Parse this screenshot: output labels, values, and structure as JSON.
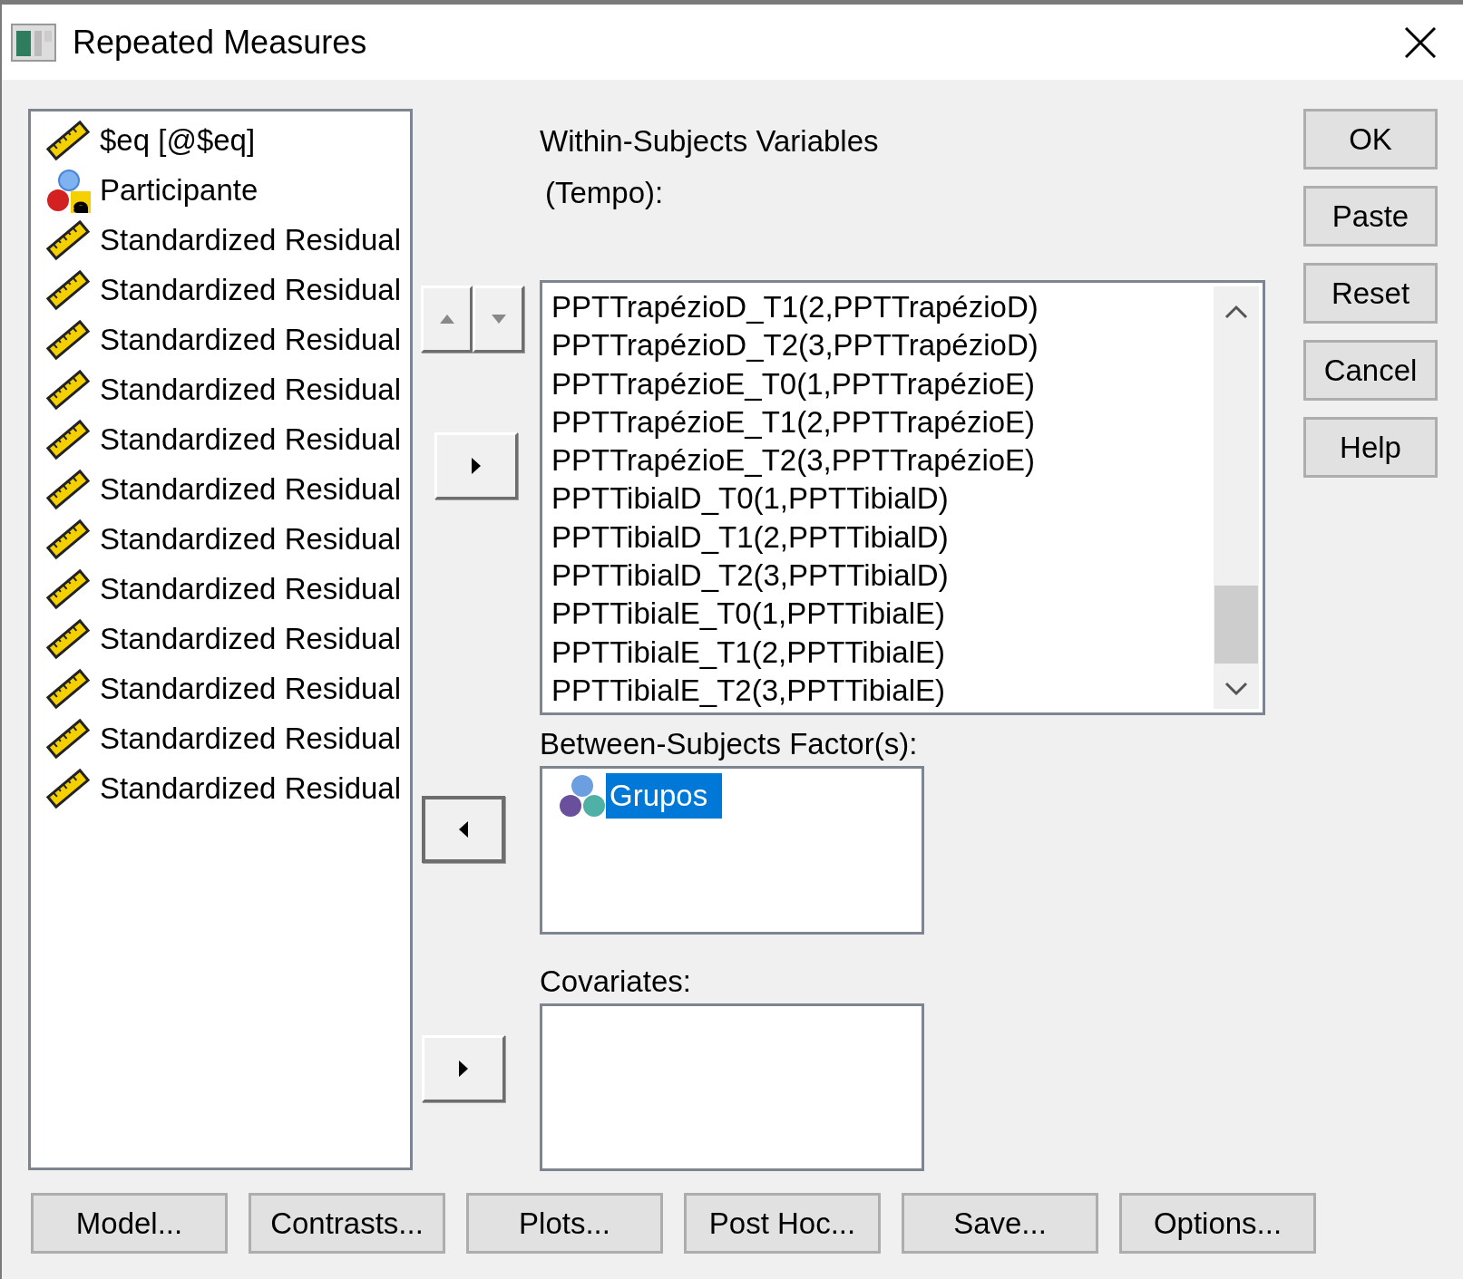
{
  "window": {
    "title": "Repeated Measures"
  },
  "variables": [
    {
      "label": "$eq [@$eq]",
      "kind": "scale"
    },
    {
      "label": "Participante",
      "kind": "nominal"
    },
    {
      "label": "Standardized Residual",
      "kind": "scale"
    },
    {
      "label": "Standardized Residual",
      "kind": "scale"
    },
    {
      "label": "Standardized Residual",
      "kind": "scale"
    },
    {
      "label": "Standardized Residual",
      "kind": "scale"
    },
    {
      "label": "Standardized Residual",
      "kind": "scale"
    },
    {
      "label": "Standardized Residual",
      "kind": "scale"
    },
    {
      "label": "Standardized Residual",
      "kind": "scale"
    },
    {
      "label": "Standardized Residual",
      "kind": "scale"
    },
    {
      "label": "Standardized Residual",
      "kind": "scale"
    },
    {
      "label": "Standardized Residual",
      "kind": "scale"
    },
    {
      "label": "Standardized Residual",
      "kind": "scale"
    },
    {
      "label": "Standardized Residual",
      "kind": "scale"
    }
  ],
  "within_subjects": {
    "label": "Within-Subjects Variables",
    "factor": "(Tempo):",
    "items": [
      "PPTTrapézioD_T1(2,PPTTrapézioD)",
      "PPTTrapézioD_T2(3,PPTTrapézioD)",
      "PPTTrapézioE_T0(1,PPTTrapézioE)",
      "PPTTrapézioE_T1(2,PPTTrapézioE)",
      "PPTTrapézioE_T2(3,PPTTrapézioE)",
      "PPTTibialD_T0(1,PPTTibialD)",
      "PPTTibialD_T1(2,PPTTibialD)",
      "PPTTibialD_T2(3,PPTTibialD)",
      "PPTTibialE_T0(1,PPTTibialE)",
      "PPTTibialE_T1(2,PPTTibialE)",
      "PPTTibialE_T2(3,PPTTibialE)"
    ]
  },
  "between_subjects": {
    "label": "Between-Subjects Factor(s):",
    "items": [
      {
        "label": "Grupos",
        "kind": "group",
        "selected": true
      }
    ]
  },
  "covariates": {
    "label": "Covariates:"
  },
  "side_buttons": [
    "OK",
    "Paste",
    "Reset",
    "Cancel",
    "Help"
  ],
  "bottom_buttons": [
    "Model...",
    "Contrasts...",
    "Plots...",
    "Post Hoc...",
    "Save...",
    "Options..."
  ]
}
